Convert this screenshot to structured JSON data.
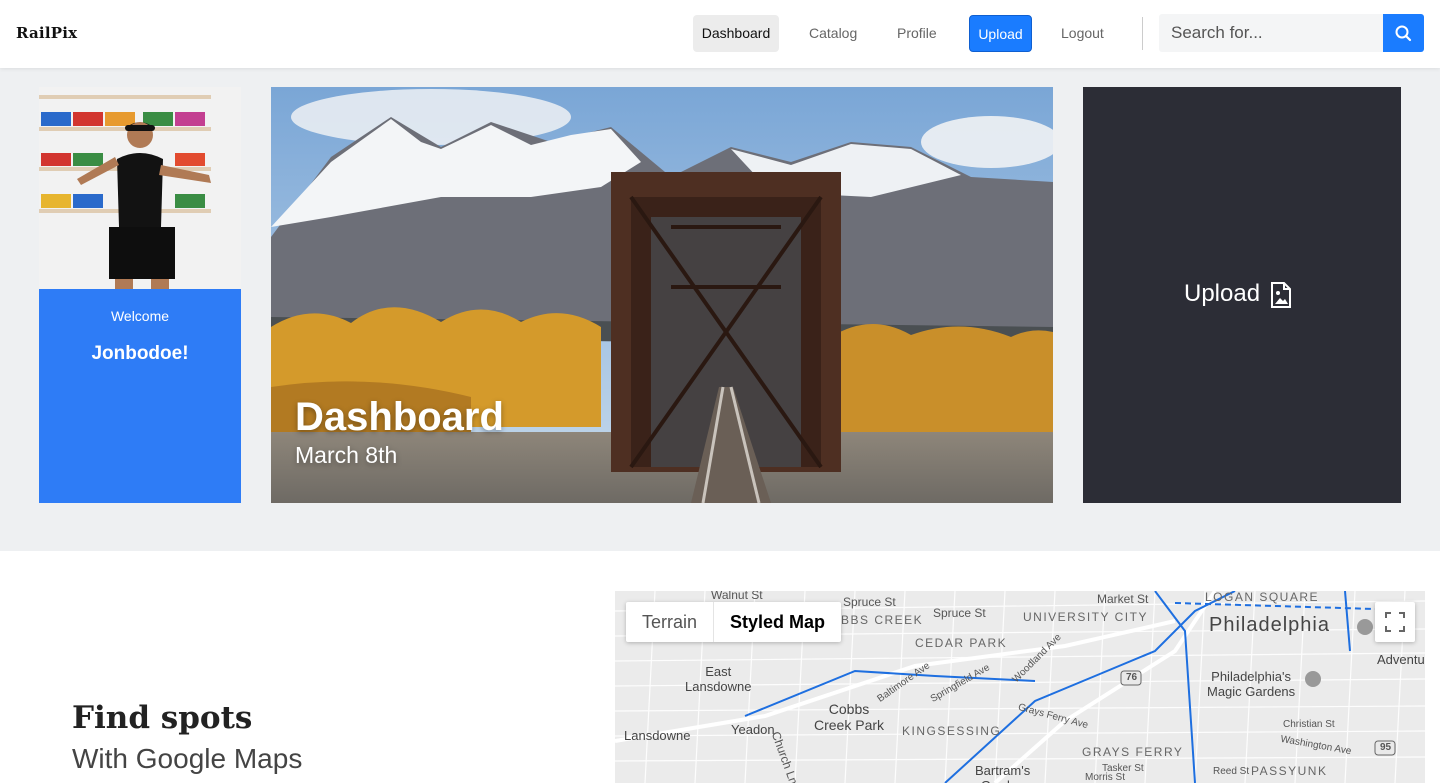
{
  "nav": {
    "brand": "RailPix",
    "links": [
      "Dashboard",
      "Catalog",
      "Profile",
      "Upload",
      "Logout"
    ],
    "search_placeholder": "Search for..."
  },
  "profile": {
    "welcome": "Welcome",
    "username": "Jonbodoe!"
  },
  "hero": {
    "title": "Dashboard",
    "date": "March 8th"
  },
  "upload_card": {
    "label": "Upload",
    "icon": "image-file-icon"
  },
  "find_spots": {
    "title": "Find spots",
    "subtitle": "With Google Maps"
  },
  "map": {
    "types": [
      "Terrain",
      "Styled Map"
    ],
    "selected_type": "Styled Map",
    "labels": {
      "walnut": "Walnut St",
      "spruce1": "Spruce St",
      "spruce2": "Spruce St",
      "market": "Market St",
      "logan": "LOGAN SQUARE",
      "cobbs_creek_cap": "BBS CREEK",
      "university": "UNIVERSITY CITY",
      "philadelphia": "Philadelphia",
      "cedar": "CEDAR PARK",
      "adventure": "Adventure Aqu",
      "east_lansdowne": "East\nLansdowne",
      "philly_garden": "Philadelphia's\nMagic Gardens",
      "cobbs": "Cobbs\nCreek Park",
      "yeadon": "Yeadon",
      "lansdowne": "Lansdowne",
      "kingsessing": "KINGSESSING",
      "grays_ferry": "GRAYS FERRY",
      "bartram": "Bartram's\nGarden",
      "passyunk": "PASSYUNK",
      "church": "Church Ln",
      "reed": "Reed St",
      "christian": "Christian St",
      "washington": "Washington Ave",
      "tasker": "Tasker St",
      "morris": "Morris St",
      "woodland": "Woodland Ave",
      "grays_ave": "Grays Ferry Ave",
      "springfield": "Springfield Ave",
      "baltimore": "Baltimore Ave",
      "route76": "76",
      "route95": "95"
    }
  },
  "colors": {
    "accent": "#1a7cff",
    "profile_card": "#2e7cf6",
    "upload_card": "#2c2d36",
    "hero_bg": "#eef0f2"
  }
}
